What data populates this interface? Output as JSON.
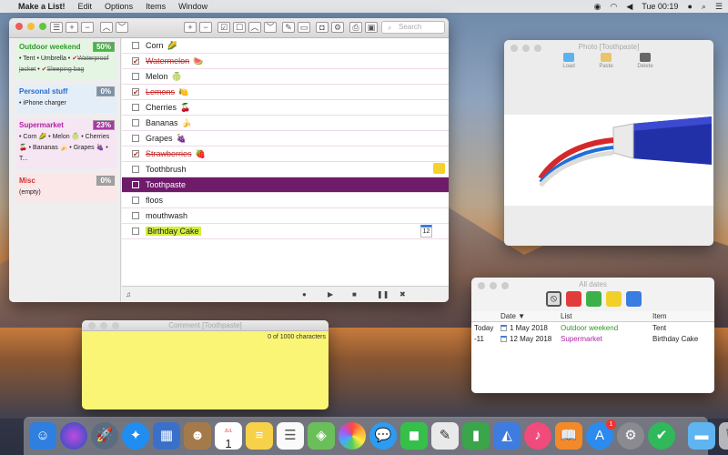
{
  "menubar": {
    "apple": "",
    "app_name": "Make a List!",
    "menus": [
      "Edit",
      "Options",
      "Items",
      "Window"
    ],
    "clock": "Tue 00:19"
  },
  "main_window": {
    "search_placeholder": "Search",
    "groups": [
      {
        "name": "Outdoor weekend",
        "percent": "50%",
        "items_text": "• Tent • Umbrella •",
        "done_text_1": "Waterproof jacket",
        "done_text_2": "Sleeping bag"
      },
      {
        "name": "Personal stuff",
        "percent": "0%",
        "items_text": "• iPhone charger"
      },
      {
        "name": "Supermarket",
        "percent": "23%",
        "items_text": "• Corn 🌽 • Melon 🍈 • Cherries 🍒 • Bananas 🍌 • Grapes 🍇 • T..."
      },
      {
        "name": "Misc",
        "percent": "0%",
        "items_text": "(empty)"
      }
    ],
    "items": [
      {
        "label": "Corn",
        "emoji": "🌽",
        "done": false
      },
      {
        "label": "Watermelon",
        "emoji": "🍉",
        "done": true
      },
      {
        "label": "Melon",
        "emoji": "🍈",
        "done": false
      },
      {
        "label": "Lemons",
        "emoji": "🍋",
        "done": true
      },
      {
        "label": "Cherries",
        "emoji": "🍒",
        "done": false
      },
      {
        "label": "Bananas",
        "emoji": "🍌",
        "done": false
      },
      {
        "label": "Grapes",
        "emoji": "🍇",
        "done": false
      },
      {
        "label": "Strawberries",
        "emoji": "🍓",
        "done": true
      },
      {
        "label": "Toothbrush",
        "emoji": "",
        "done": false
      },
      {
        "label": "Toothpaste",
        "emoji": "",
        "done": false
      },
      {
        "label": "floos",
        "emoji": "",
        "done": false
      },
      {
        "label": "mouthwash",
        "emoji": "",
        "done": false
      },
      {
        "label": "Birthday Cake",
        "emoji": "",
        "done": false
      }
    ],
    "calendar_badge": "12"
  },
  "photo_window": {
    "title": "Photo [Toothpaste]",
    "load_label": "Load",
    "paste_label": "Paste",
    "delete_label": "Delete"
  },
  "dates_window": {
    "title": "All dates",
    "headers": {
      "date": "Date ▼",
      "list": "List",
      "item": "Item"
    },
    "rows": [
      {
        "offset": "Today",
        "date": "1 May 2018",
        "list": "Outdoor weekend",
        "item": "Tent",
        "list_color": "#2f9a2a"
      },
      {
        "offset": "-11",
        "date": "12 May 2018",
        "list": "Supermarket",
        "item": "Birthday Cake",
        "list_color": "#b021a4"
      }
    ],
    "filter_colors": [
      "#e23b3b",
      "#3db04a",
      "#f1d02a",
      "#3a7de0"
    ]
  },
  "comment_window": {
    "title": "Comment [Toothpaste]",
    "char_count": "0 of 1000 characters"
  },
  "dock": {
    "calendar_month": "JUL",
    "calendar_day": "1",
    "appstore_badge": "1"
  }
}
